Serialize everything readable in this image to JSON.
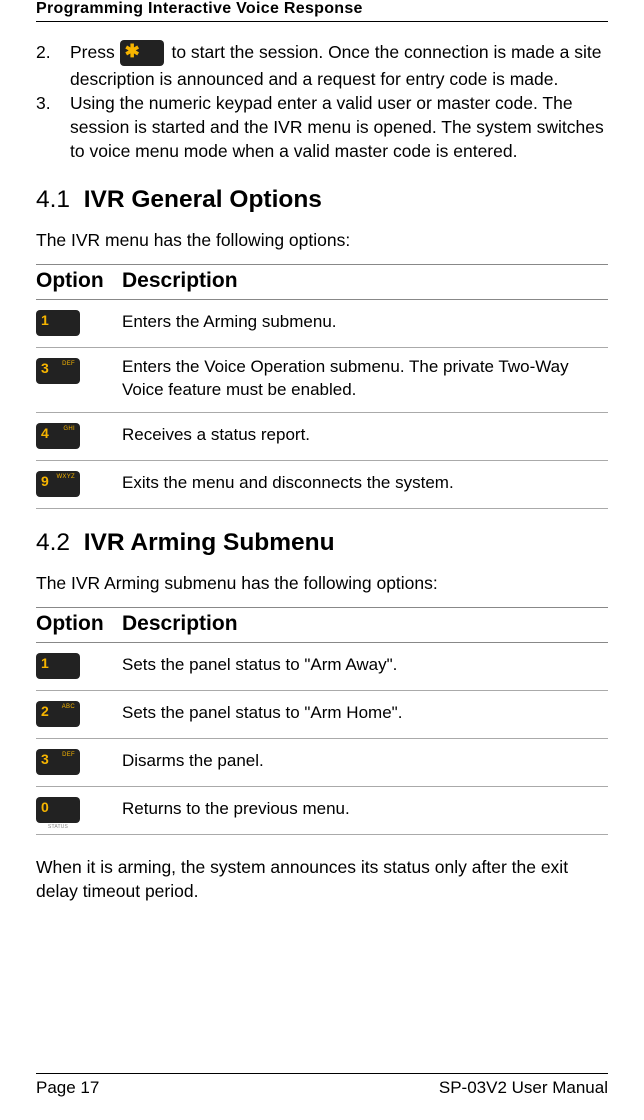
{
  "header": "Programming Interactive Voice Response",
  "steps": [
    {
      "num": "2.",
      "pre": "Press ",
      "key": {
        "sym": "✱",
        "sup": "",
        "lab": ""
      },
      "post": " to start the session. Once the connection is made a site description is announced and a request for entry code is made."
    },
    {
      "num": "3.",
      "pre": "",
      "key": null,
      "post": "Using the numeric keypad enter a valid user or master code. The session is started and the IVR menu is opened. The system switches to voice menu mode when a valid master code is entered."
    }
  ],
  "sections": [
    {
      "num": "4.1",
      "title": "IVR General Options",
      "lead": "The IVR menu has the following options:",
      "columns": [
        "Option",
        "Description"
      ],
      "rows": [
        {
          "key": {
            "sym": "1",
            "sup": "",
            "lab": ""
          },
          "desc": "Enters the Arming submenu."
        },
        {
          "key": {
            "sym": "3",
            "sup": "DEF",
            "lab": ""
          },
          "desc": "Enters the Voice Operation submenu. The private Two-Way Voice feature must be enabled."
        },
        {
          "key": {
            "sym": "4",
            "sup": "GHI",
            "lab": ""
          },
          "desc": "Receives a status report."
        },
        {
          "key": {
            "sym": "9",
            "sup": "WXYZ",
            "lab": ""
          },
          "desc": "Exits the menu and disconnects the system."
        }
      ],
      "note": ""
    },
    {
      "num": "4.2",
      "title": "IVR Arming Submenu",
      "lead": "The IVR Arming submenu has the following options:",
      "columns": [
        "Option",
        "Description"
      ],
      "rows": [
        {
          "key": {
            "sym": "1",
            "sup": "",
            "lab": ""
          },
          "desc": "Sets the panel status to \"Arm Away\"."
        },
        {
          "key": {
            "sym": "2",
            "sup": "ABC",
            "lab": ""
          },
          "desc": "Sets the panel status to \"Arm Home\"."
        },
        {
          "key": {
            "sym": "3",
            "sup": "DEF",
            "lab": ""
          },
          "desc": "Disarms the panel."
        },
        {
          "key": {
            "sym": "0",
            "sup": "",
            "lab": "STATUS"
          },
          "desc": "Returns to the previous menu."
        }
      ],
      "note": "When it is arming, the system announces its status only after the exit delay timeout period."
    }
  ],
  "footer": {
    "left": "Page 17",
    "right": "SP-03V2 User Manual"
  }
}
